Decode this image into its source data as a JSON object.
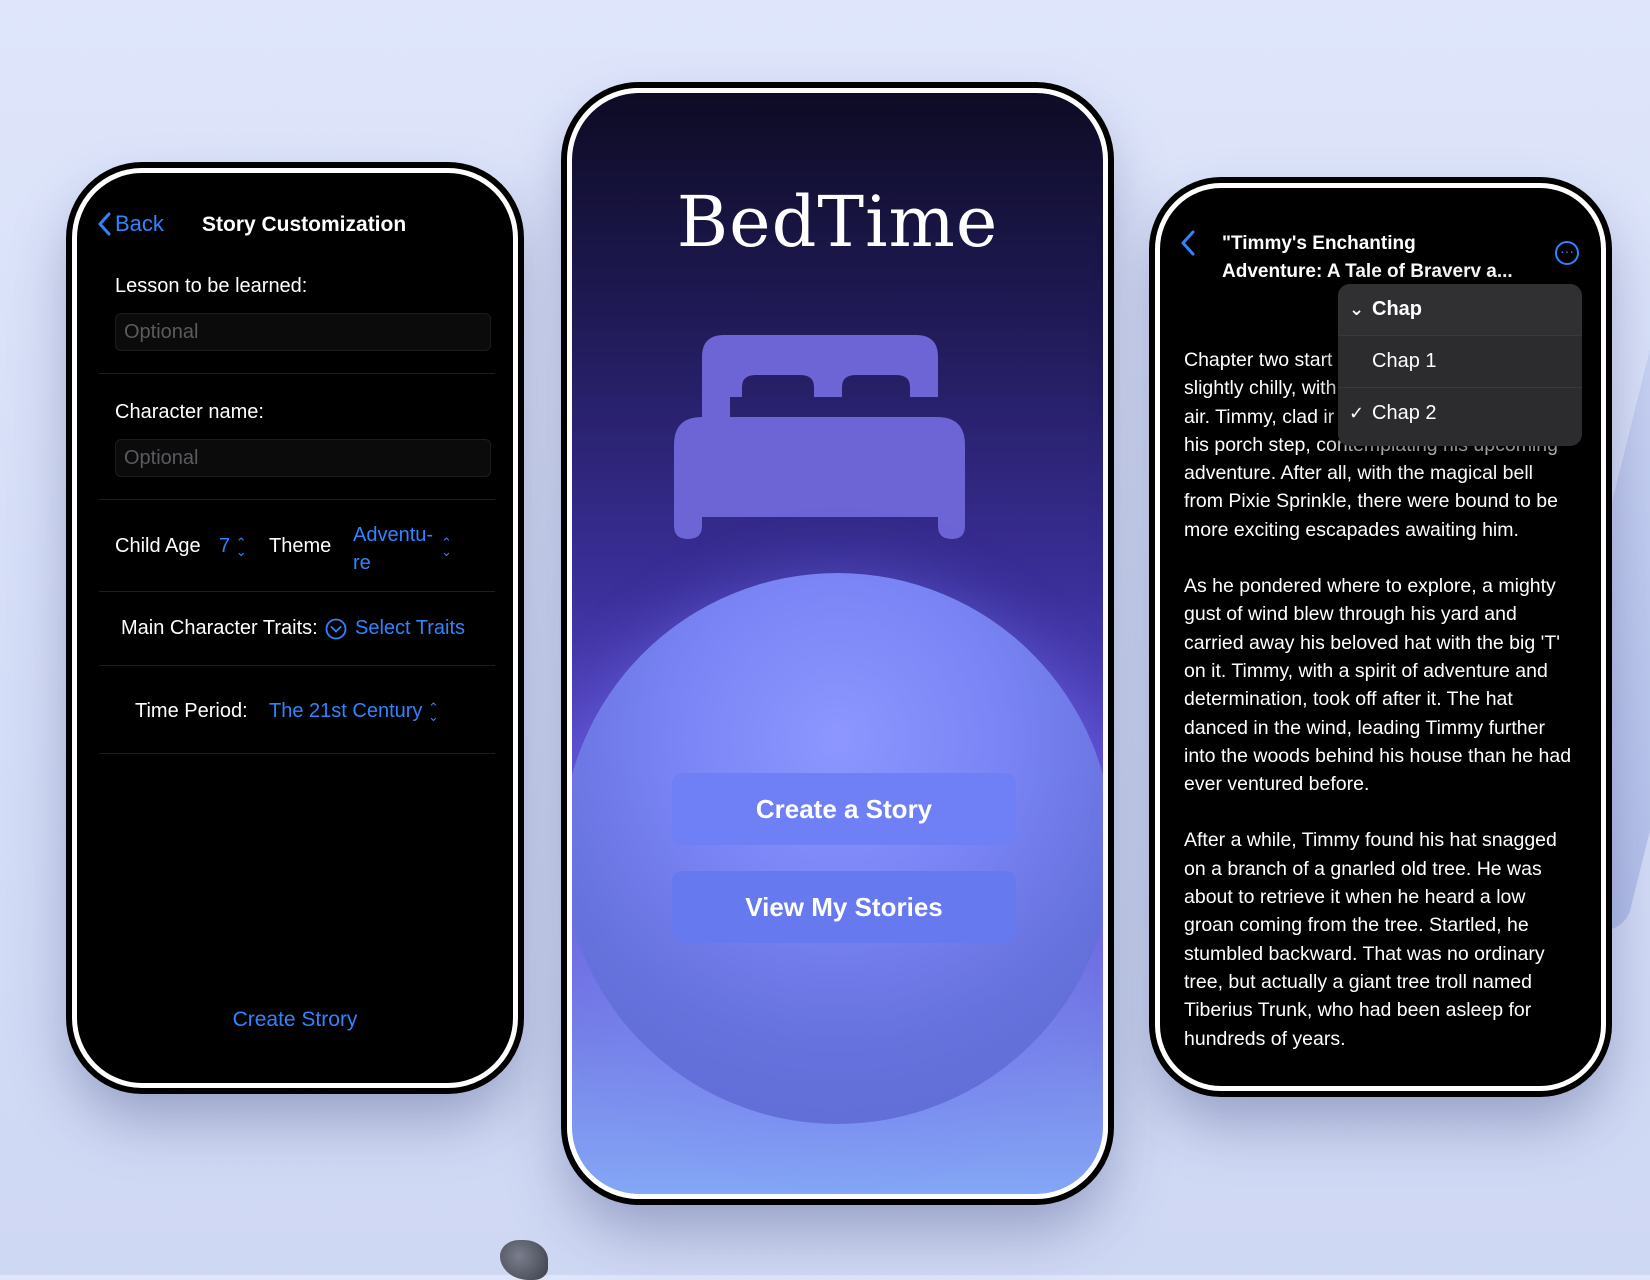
{
  "customization": {
    "back_label": "Back",
    "title": "Story Customization",
    "lesson_label": "Lesson to be learned:",
    "lesson_placeholder": "Optional",
    "character_label": "Character name:",
    "character_placeholder": "Optional",
    "age_label": "Child Age",
    "age_value": "7",
    "theme_label": "Theme",
    "theme_value_line1": "Adventu-",
    "theme_value_line2": "re",
    "traits_label": "Main Character Traits:",
    "traits_button": "Select Traits",
    "period_label": "Time Period:",
    "period_value": "The 21st Century",
    "create_button": "Create Strory"
  },
  "home": {
    "app_title": "BedTime",
    "create_button": "Create a Story",
    "view_button": "View My Stories"
  },
  "reader": {
    "title_line1": "\"Timmy's Enchanting",
    "title_line2": "Adventure: A Tale of Braverv a...",
    "more_icon": "ellipsis-circle-icon",
    "menu": {
      "header": "Chap",
      "items": [
        {
          "label": "Chap 1",
          "checked": false
        },
        {
          "label": "Chap 2",
          "checked": true
        }
      ]
    },
    "para1": "Chapter two started slightly chilly, with air. Timmy, clad in his porch step, contemplating his upcoming adventure. After all, with the magical bell from Pixie Sprinkle, there were bound to be more exciting escapades awaiting him.",
    "para1_lines": [
      "Chapter two start",
      "slightly chilly, with",
      "air. Timmy, clad ir",
      "his porch step, contemplating his upcoming",
      "adventure. After all, with the magical bell",
      "from Pixie Sprinkle, there were bound to be",
      "more exciting escapades awaiting him."
    ],
    "para2": "As he pondered where to explore, a mighty gust of wind blew through his yard and carried away his beloved hat with the big 'T' on it. Timmy, with a spirit of adventure and determination, took off after it. The hat danced in the wind, leading Timmy further into the woods behind his house than he had ever ventured before.",
    "para3": "After a while, Timmy found his hat snagged on a branch of a gnarled old tree. He was about to retrieve it when he heard a low groan coming from the tree. Startled, he stumbled backward. That was no ordinary tree, but actually a giant tree troll named Tiberius Trunk, who had been asleep for hundreds of years."
  },
  "colors": {
    "accent": "#2f84ff",
    "button": "#6f7ff6",
    "background": "#dfe6fb"
  }
}
